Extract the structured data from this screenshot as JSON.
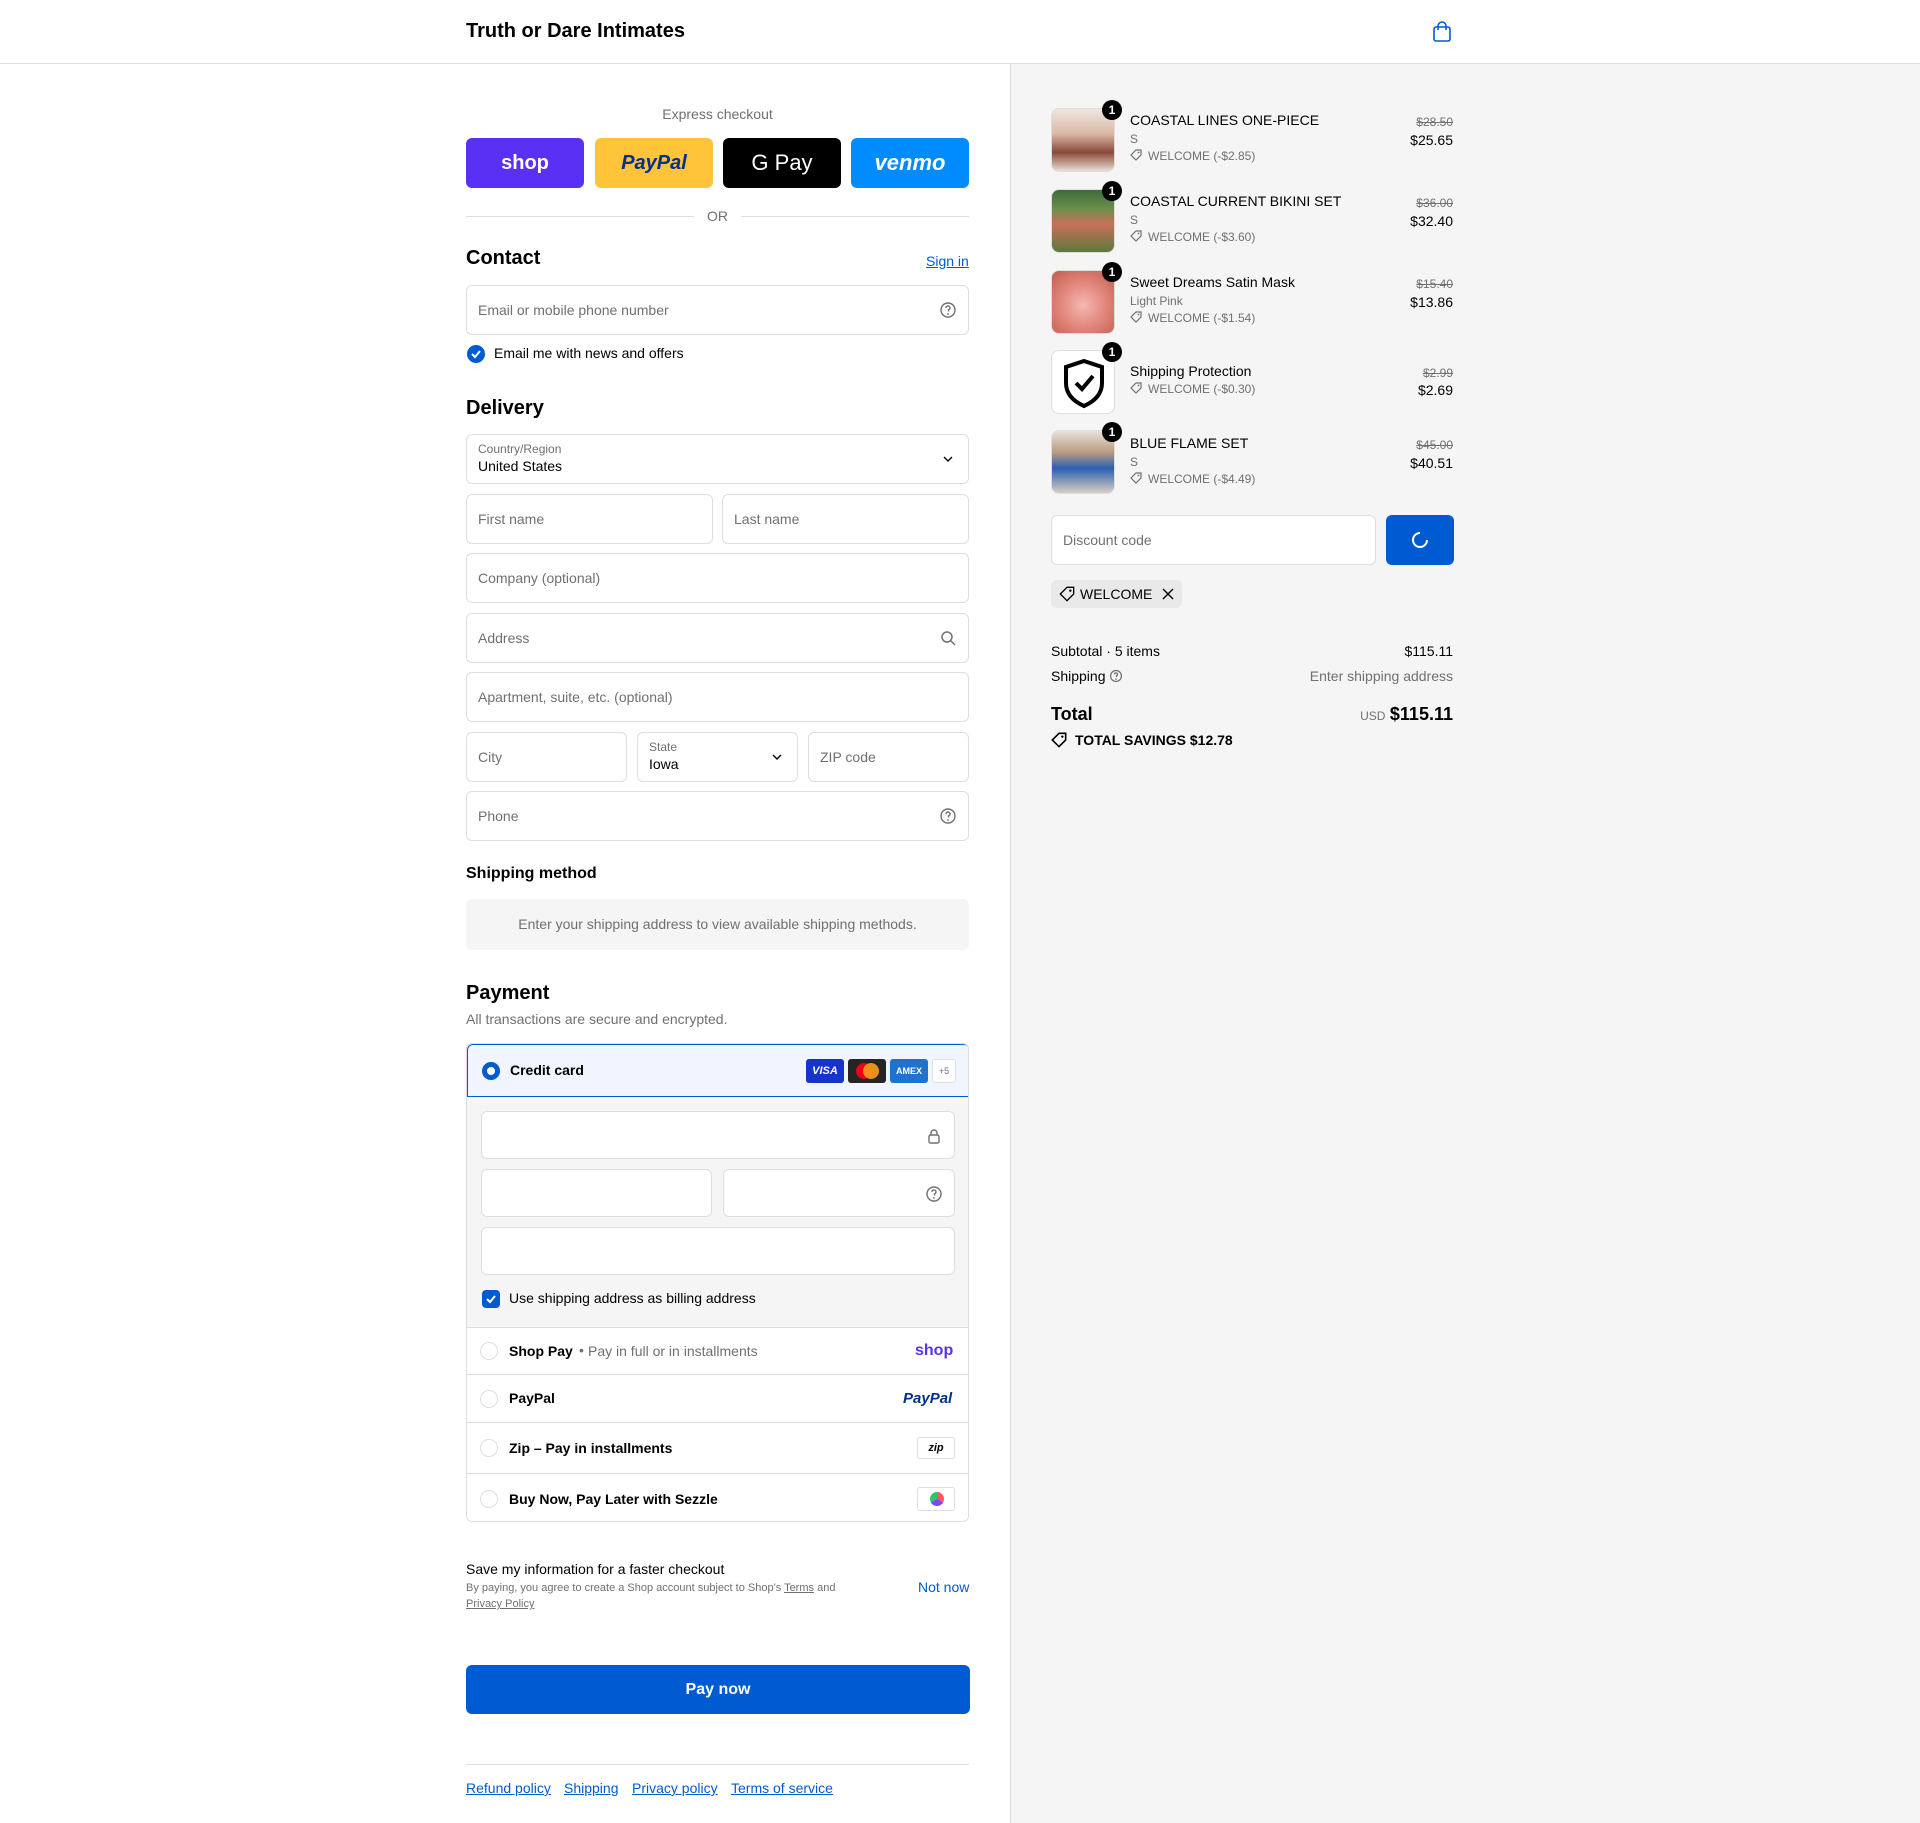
{
  "header": {
    "store_name": "Truth or Dare Intimates",
    "cart_icon": "shopping-bag-icon"
  },
  "express": {
    "title": "Express checkout",
    "buttons": [
      {
        "label": "shop",
        "color": "#5a31f4"
      },
      {
        "label": "PayPal",
        "color": "#ffc439"
      },
      {
        "label": "G Pay",
        "color": "#000000"
      },
      {
        "label": "venmo",
        "color": "#008cff"
      }
    ],
    "or": "OR"
  },
  "contact": {
    "title": "Contact",
    "sign_in": "Sign in",
    "email_placeholder": "Email or mobile phone number",
    "news_label": "Email me with news and offers"
  },
  "delivery": {
    "title": "Delivery",
    "country_label": "Country/Region",
    "country_value": "United States",
    "first_name": "First name",
    "last_name": "Last name",
    "company": "Company (optional)",
    "address": "Address",
    "apartment": "Apartment, suite, etc. (optional)",
    "city": "City",
    "state_label": "State",
    "state_value": "Iowa",
    "zip": "ZIP code",
    "phone": "Phone"
  },
  "shipping_method": {
    "title": "Shipping method",
    "message": "Enter your shipping address to view available shipping methods."
  },
  "payment": {
    "title": "Payment",
    "subtitle": "All transactions are secure and encrypted.",
    "credit_card": "Credit card",
    "cards": [
      "VISA",
      "MC",
      "AMEX"
    ],
    "more_cards": "+5",
    "billing_label": "Use shipping address as billing address",
    "shop_pay": "Shop Pay",
    "shop_pay_sub": "Pay in full or in installments",
    "shop_pay_logo": "shop",
    "paypal": "PayPal",
    "paypal_logo": "PayPal",
    "zip": "Zip – Pay in installments",
    "zip_logo": "zip",
    "sezzle": "Buy Now, Pay Later with Sezzle"
  },
  "save_info": {
    "title": "Save my information for a faster checkout",
    "text_1": "By paying, you agree to create a Shop account subject to Shop's",
    "terms": "Terms",
    "and": "and",
    "privacy": "Privacy Policy",
    "not_now": "Not now"
  },
  "pay_now": "Pay now",
  "footer_links": [
    "Refund policy",
    "Shipping",
    "Privacy policy",
    "Terms of service"
  ],
  "items": [
    {
      "name": "COASTAL LINES ONE-PIECE",
      "variant": "S",
      "discount": "WELCOME (-$2.85)",
      "orig": "$28.50",
      "price": "$25.65",
      "qty": "1"
    },
    {
      "name": "COASTAL CURRENT BIKINI SET",
      "variant": "S",
      "discount": "WELCOME (-$3.60)",
      "orig": "$36.00",
      "price": "$32.40",
      "qty": "1"
    },
    {
      "name": "Sweet Dreams Satin Mask",
      "variant": "Light Pink",
      "discount": "WELCOME (-$1.54)",
      "orig": "$15.40",
      "price": "$13.86",
      "qty": "1"
    },
    {
      "name": "Shipping Protection",
      "variant": "",
      "discount": "WELCOME (-$0.30)",
      "orig": "$2.99",
      "price": "$2.69",
      "qty": "1"
    },
    {
      "name": "BLUE FLAME SET",
      "variant": "S",
      "discount": "WELCOME (-$4.49)",
      "orig": "$45.00",
      "price": "$40.51",
      "qty": "1"
    }
  ],
  "discount": {
    "placeholder": "Discount code",
    "applied": "WELCOME"
  },
  "totals": {
    "subtotal_label": "Subtotal · 5 items",
    "subtotal": "$115.11",
    "shipping_label": "Shipping",
    "shipping_value": "Enter shipping address",
    "total_label": "Total",
    "currency": "USD",
    "total": "$115.11",
    "savings_label": "TOTAL SAVINGS",
    "savings": "$12.78"
  }
}
